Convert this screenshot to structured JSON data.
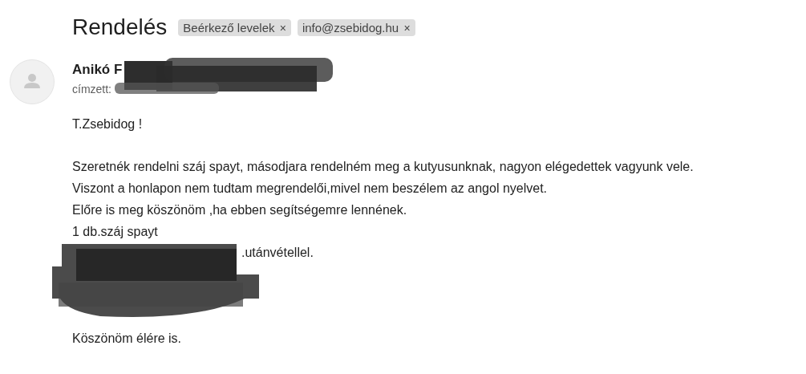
{
  "subject": "Rendelés",
  "labels": [
    {
      "text": "Beérkező levelek",
      "close": "×"
    },
    {
      "text": "info@zsebidog.hu",
      "close": "×"
    }
  ],
  "sender": {
    "name": "Anikó F",
    "redacted": true
  },
  "recipient": {
    "label": "címzett:",
    "redacted": true
  },
  "body": [
    {
      "kind": "text",
      "text": "T.Zsebidog !"
    },
    {
      "kind": "gap"
    },
    {
      "kind": "text",
      "text": "Szeretnék rendelni száj spayt, másodjara rendelném meg a kutyusunknak, nagyon elégedettek vagyunk vele."
    },
    {
      "kind": "text",
      "text": "Viszont a honlapon nem tudtam megrendelői,mivel nem beszélem az angol nyelvet."
    },
    {
      "kind": "text",
      "text": "Előre is meg köszönöm ,ha ebben segítségemre lennének."
    },
    {
      "kind": "text",
      "text": "1 db.száj spayt"
    },
    {
      "kind": "redacted",
      "text": ".utánvétellel."
    },
    {
      "kind": "gap"
    },
    {
      "kind": "text",
      "text": "Köszönöm élére is."
    }
  ]
}
